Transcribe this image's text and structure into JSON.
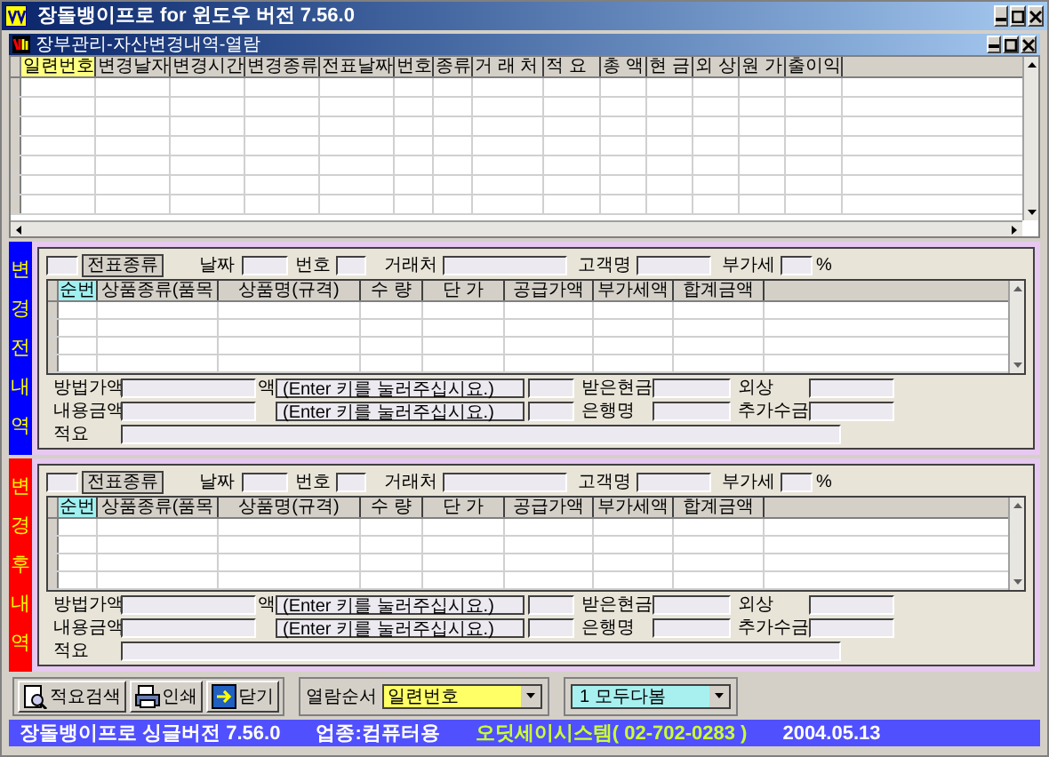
{
  "window": {
    "title": "장돌뱅이프로 for 윈도우 버전 7.56.0"
  },
  "document": {
    "title": "장부관리-자산변경내역-열람"
  },
  "history_table": {
    "columns": [
      {
        "label": "일련번호",
        "selected": true
      },
      {
        "label": "변경날자",
        "selected": false
      },
      {
        "label": "변경시간",
        "selected": false
      },
      {
        "label": "변경종류",
        "selected": false
      },
      {
        "label": "전표날짜",
        "selected": false
      },
      {
        "label": "번호",
        "selected": false
      },
      {
        "label": "종류",
        "selected": false
      },
      {
        "label": "거 래 처",
        "selected": false
      },
      {
        "label": "적 요",
        "selected": false
      },
      {
        "label": "총 액",
        "selected": false
      },
      {
        "label": "현 금",
        "selected": false
      },
      {
        "label": "외 상",
        "selected": false
      },
      {
        "label": "원 가",
        "selected": false
      },
      {
        "label": "출이익",
        "selected": false
      }
    ]
  },
  "panels": [
    {
      "label": "변경전내역",
      "color": "#0000ff",
      "voucher_type_button": "전표종류",
      "date_label": "날짜",
      "number_label": "번호",
      "client_label": "거래처",
      "customer_label": "고객명",
      "vat_label": "부가세",
      "vat_unit": "%",
      "columns": [
        {
          "label": "순번",
          "selected": true
        },
        {
          "label": "상품종류(품목",
          "selected": false
        },
        {
          "label": "상품명(규격)",
          "selected": false
        },
        {
          "label": "수 량",
          "selected": false
        },
        {
          "label": "단 가",
          "selected": false
        },
        {
          "label": "공급가액",
          "selected": false
        },
        {
          "label": "부가세액",
          "selected": false
        },
        {
          "label": "합계금액",
          "selected": false
        }
      ],
      "rows": [
        {
          "label": "방법가액",
          "cut_label": "액",
          "hint": "(Enter 키를 눌러주십시요.)",
          "label_2": "받은현금",
          "label_3": "외상"
        },
        {
          "label": "내용금액",
          "hint": "(Enter 키를 눌러주십시요.)",
          "label_2": "은행명",
          "label_3": "추가수금"
        }
      ],
      "memo_label": "적요"
    },
    {
      "label": "변경후내역",
      "color": "#ff0000",
      "voucher_type_button": "전표종류",
      "date_label": "날짜",
      "number_label": "번호",
      "client_label": "거래처",
      "customer_label": "고객명",
      "vat_label": "부가세",
      "vat_unit": "%",
      "columns": [
        {
          "label": "순번",
          "selected": true
        },
        {
          "label": "상품종류(품목",
          "selected": false
        },
        {
          "label": "상품명(규격)",
          "selected": false
        },
        {
          "label": "수 량",
          "selected": false
        },
        {
          "label": "단 가",
          "selected": false
        },
        {
          "label": "공급가액",
          "selected": false
        },
        {
          "label": "부가세액",
          "selected": false
        },
        {
          "label": "합계금액",
          "selected": false
        }
      ],
      "rows": [
        {
          "label": "방법가액",
          "cut_label": "액",
          "hint": "(Enter 키를 눌러주십시요.)",
          "label_2": "받은현금",
          "label_3": "외상"
        },
        {
          "label": "내용금액",
          "hint": "(Enter 키를 눌러주십시요.)",
          "label_2": "은행명",
          "label_3": "추가수금"
        }
      ],
      "memo_label": "적요"
    }
  ],
  "toolbar": {
    "buttons": [
      {
        "label": "적요검색",
        "kind": "search"
      },
      {
        "label": "인쇄",
        "kind": "print"
      },
      {
        "label": "닫기",
        "kind": "close"
      }
    ],
    "sort_label": "열람순서",
    "sort_select": {
      "value": "일련번호"
    },
    "view_select": {
      "value": "1 모두다봄"
    }
  },
  "status_bar": [
    {
      "text": "장돌뱅이프로 싱글버전 7.56.0",
      "color": "#ffffff"
    },
    {
      "text": "업종:컴퓨터용",
      "color": "#ffffff"
    },
    {
      "text": "오딧세이시스템( 02-702-0283 )",
      "color": "#ccff33"
    },
    {
      "text": "2004.05.13",
      "color": "#ffffff"
    }
  ]
}
